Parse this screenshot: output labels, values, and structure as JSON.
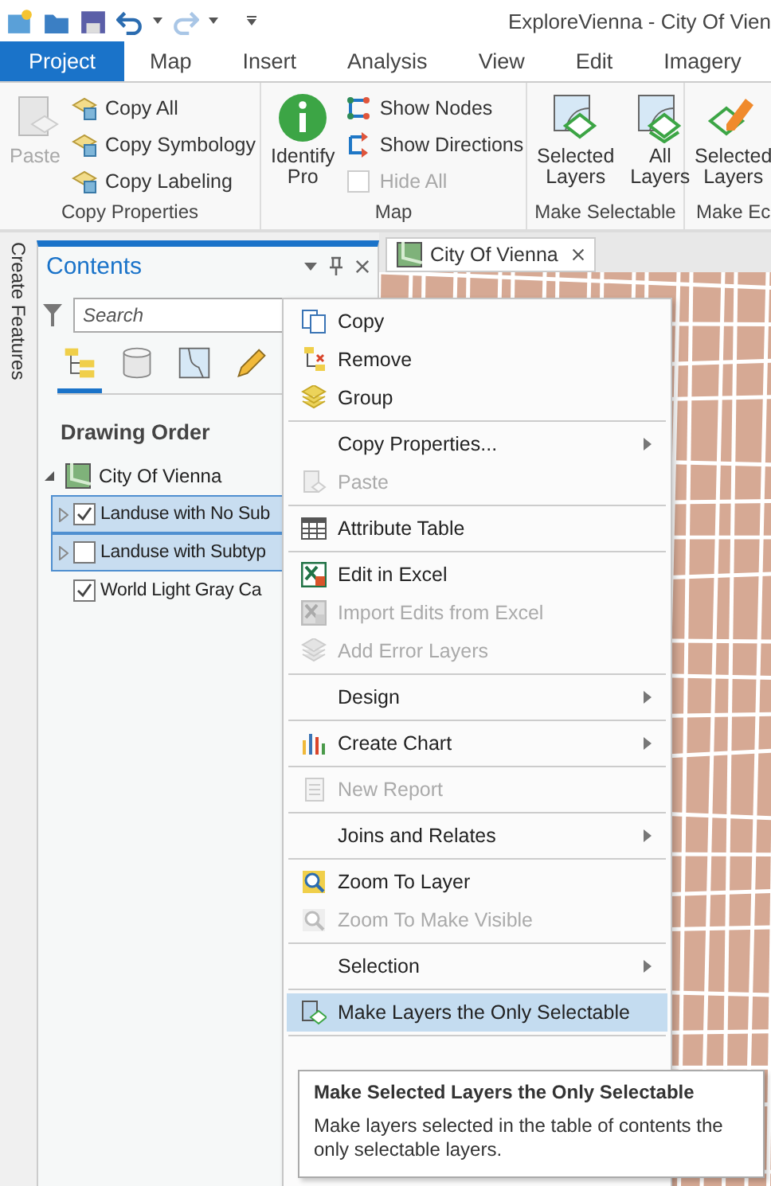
{
  "quick_access": {
    "title": "ExploreVienna - City Of Vien"
  },
  "ribbon_tabs": [
    {
      "label": "Project",
      "selected": true
    },
    {
      "label": "Map",
      "selected": false
    },
    {
      "label": "Insert",
      "selected": false
    },
    {
      "label": "Analysis",
      "selected": false
    },
    {
      "label": "View",
      "selected": false
    },
    {
      "label": "Edit",
      "selected": false
    },
    {
      "label": "Imagery",
      "selected": false
    }
  ],
  "ribbon_groups": [
    {
      "label": "Copy Properties",
      "large": [
        {
          "label": "Paste",
          "disabled": true
        }
      ],
      "small": [
        {
          "label": "Copy All",
          "disabled": false
        },
        {
          "label": "Copy Symbology",
          "disabled": false
        },
        {
          "label": "Copy Labeling",
          "disabled": false
        }
      ]
    },
    {
      "label": "Map",
      "large": [
        {
          "label": "Identify Pro",
          "disabled": false
        }
      ],
      "small": [
        {
          "label": "Show Nodes",
          "disabled": false
        },
        {
          "label": "Show Directions",
          "disabled": false
        },
        {
          "label": "Hide All",
          "disabled": true
        }
      ]
    },
    {
      "label": "Make Selectable",
      "large": [
        {
          "label": "Selected Layers",
          "disabled": false
        },
        {
          "label": "All Layers",
          "disabled": false
        }
      ]
    },
    {
      "label": "Make Ec",
      "large": [
        {
          "label": "Selected Layers",
          "disabled": false
        }
      ]
    }
  ],
  "side_strip": {
    "label": "Create Features"
  },
  "contents": {
    "title": "Contents",
    "search": {
      "placeholder": "Search"
    },
    "views": [
      {
        "selected": true
      },
      {
        "selected": false
      },
      {
        "selected": false
      },
      {
        "selected": false
      }
    ],
    "heading": "Drawing Order",
    "tree": [
      {
        "label": "City Of Vienna",
        "expanded": true,
        "children": [
          {
            "label": "Landuse with No Sub",
            "checked": true,
            "selected": true,
            "expandable": true
          },
          {
            "label": "Landuse with Subtyp",
            "checked": false,
            "selected": true,
            "expandable": true
          },
          {
            "label": "World Light Gray Ca",
            "checked": true,
            "selected": false,
            "expandable": false
          }
        ]
      }
    ]
  },
  "map_tabs": [
    {
      "label": "City Of Vienna",
      "selected": true
    }
  ],
  "context_menu": {
    "sections": [
      [
        {
          "label": "Copy",
          "disabled": false,
          "submenu": false,
          "highlighted": false
        },
        {
          "label": "Remove",
          "disabled": false,
          "submenu": false,
          "highlighted": false
        },
        {
          "label": "Group",
          "disabled": false,
          "submenu": false,
          "highlighted": false
        }
      ],
      [
        {
          "label": "Copy Properties...",
          "disabled": false,
          "submenu": true,
          "highlighted": false
        },
        {
          "label": "Paste",
          "disabled": true,
          "submenu": false,
          "highlighted": false
        }
      ],
      [
        {
          "label": "Attribute Table",
          "disabled": false,
          "submenu": false,
          "highlighted": false
        }
      ],
      [
        {
          "label": "Edit in Excel",
          "disabled": false,
          "submenu": false,
          "highlighted": false
        },
        {
          "label": "Import Edits from Excel",
          "disabled": true,
          "submenu": false,
          "highlighted": false
        },
        {
          "label": "Add Error Layers",
          "disabled": true,
          "submenu": false,
          "highlighted": false
        }
      ],
      [
        {
          "label": "Design",
          "disabled": false,
          "submenu": true,
          "highlighted": false
        }
      ],
      [
        {
          "label": "Create Chart",
          "disabled": false,
          "submenu": true,
          "highlighted": false
        }
      ],
      [
        {
          "label": "New Report",
          "disabled": true,
          "submenu": false,
          "highlighted": false
        }
      ],
      [
        {
          "label": "Joins and Relates",
          "disabled": false,
          "submenu": true,
          "highlighted": false
        }
      ],
      [
        {
          "label": "Zoom To Layer",
          "disabled": false,
          "submenu": false,
          "highlighted": false
        },
        {
          "label": "Zoom To Make Visible",
          "disabled": true,
          "submenu": false,
          "highlighted": false
        }
      ],
      [
        {
          "label": "Selection",
          "disabled": false,
          "submenu": true,
          "highlighted": false
        }
      ],
      [
        {
          "label": "Make Layers the Only Selectable",
          "disabled": false,
          "submenu": false,
          "highlighted": true
        }
      ]
    ]
  },
  "tooltip": {
    "title": "Make Selected Layers the Only Selectable",
    "text": "Make layers selected in the table of contents the only selectable layers."
  }
}
